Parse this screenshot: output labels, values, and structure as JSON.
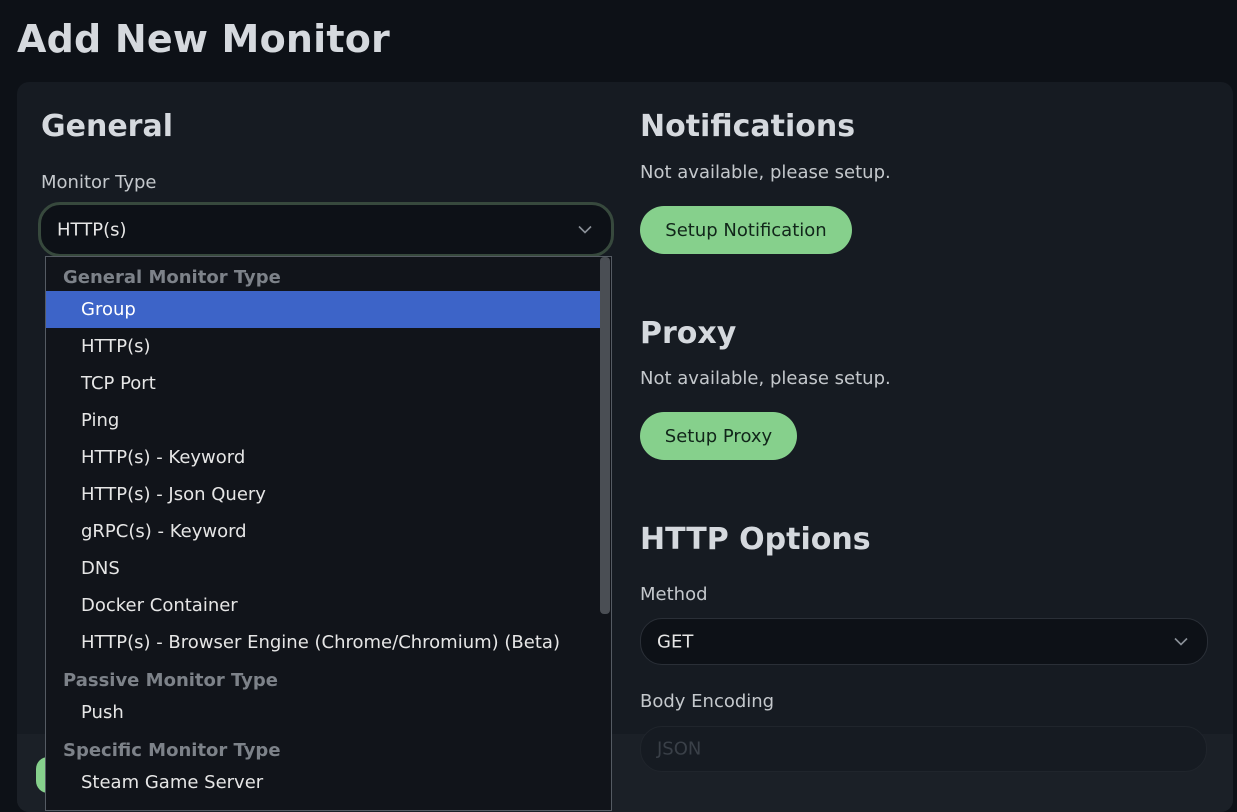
{
  "page": {
    "title": "Add New Monitor"
  },
  "general": {
    "title": "General",
    "monitor_type_label": "Monitor Type",
    "monitor_type_value": "HTTP(s)"
  },
  "notifications": {
    "title": "Notifications",
    "empty_text": "Not available, please setup.",
    "setup_button": "Setup Notification"
  },
  "proxy": {
    "title": "Proxy",
    "empty_text": "Not available, please setup.",
    "setup_button": "Setup Proxy"
  },
  "http_options": {
    "title": "HTTP Options",
    "method_label": "Method",
    "method_value": "GET",
    "body_encoding_label": "Body Encoding",
    "body_encoding_value": "JSON"
  },
  "dropdown": {
    "groups": [
      {
        "label": "General Monitor Type",
        "options": [
          "Group",
          "HTTP(s)",
          "TCP Port",
          "Ping",
          "HTTP(s) - Keyword",
          "HTTP(s) - Json Query",
          "gRPC(s) - Keyword",
          "DNS",
          "Docker Container",
          "HTTP(s) - Browser Engine (Chrome/Chromium) (Beta)"
        ]
      },
      {
        "label": "Passive Monitor Type",
        "options": [
          "Push"
        ]
      },
      {
        "label": "Specific Monitor Type",
        "options": [
          "Steam Game Server"
        ]
      }
    ],
    "highlighted": "Group"
  },
  "colors": {
    "accent_green": "#86d08c",
    "highlight_blue": "#3d64c8",
    "background": "#0d1117",
    "card": "#161b22"
  },
  "icons": {
    "select_caret": "chevron-down-icon"
  }
}
